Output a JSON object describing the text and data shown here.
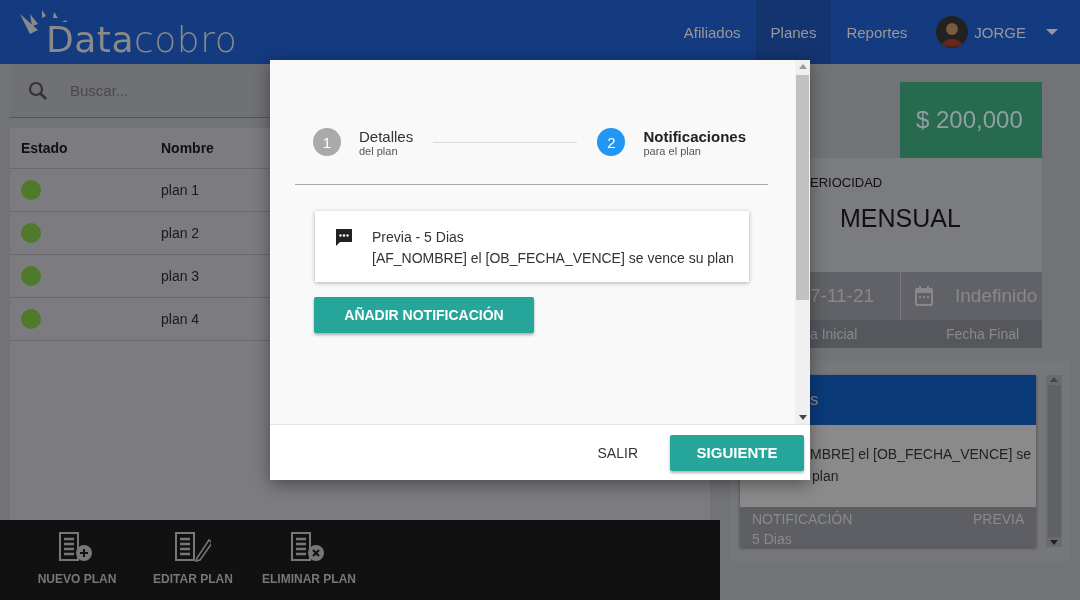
{
  "header": {
    "logo": {
      "bold": "Data",
      "light": "cobro"
    },
    "nav": [
      {
        "label": "Afiliados",
        "selected": false
      },
      {
        "label": "Planes",
        "selected": true
      },
      {
        "label": "Reportes",
        "selected": false
      }
    ],
    "user": {
      "name": "JORGE"
    }
  },
  "search": {
    "placeholder": "Buscar..."
  },
  "table": {
    "columns": [
      "Estado",
      "Nombre"
    ],
    "rows": [
      {
        "active": true,
        "name": "plan 1"
      },
      {
        "active": true,
        "name": "plan 2"
      },
      {
        "active": true,
        "name": "plan 3"
      },
      {
        "active": true,
        "name": "plan 4"
      }
    ]
  },
  "actions": [
    {
      "kind": "add",
      "label": "NUEVO PLAN"
    },
    {
      "kind": "edit",
      "label": "EDITAR PLAN"
    },
    {
      "kind": "delete",
      "label": "ELIMINAR PLAN"
    }
  ],
  "detail": {
    "price": "$ 200,000",
    "periodicity_label": "ERIOCIDAD",
    "periodicity": "MENSUAL",
    "start_date": "7-11-21",
    "end_date": "Indefinido",
    "start_label": "a Inicial",
    "end_label": "Fecha Final"
  },
  "notification_card": {
    "title": "s",
    "message_line_1": "MBRE] el [OB_FECHA_VENCE] se",
    "message_line_2": "plan",
    "footer_label": "NOTIFICACIÓN",
    "footer_type": "PREVIA",
    "footer_days": "5 Dias"
  },
  "dialog": {
    "steps": [
      {
        "number": "1",
        "title": "Detalles",
        "subtitle": "del plan",
        "selected": false
      },
      {
        "number": "2",
        "title": "Notificaciones",
        "subtitle": "para el plan",
        "selected": true
      }
    ],
    "notifications": [
      {
        "title": "Previa - 5 Dias",
        "message": "[AF_NOMBRE] el [OB_FECHA_VENCE] se vence su plan"
      }
    ],
    "add_button": "AÑADIR NOTIFICACIÓN",
    "cancel_button": "SALIR",
    "next_button": "SIGUIENTE"
  }
}
